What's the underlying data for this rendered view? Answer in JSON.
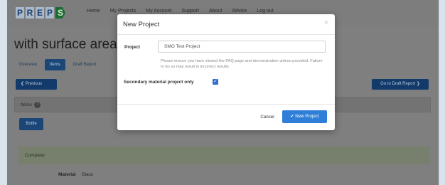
{
  "nav": {
    "logo_letters": [
      "P",
      "R",
      "E",
      "P",
      "S"
    ],
    "items": [
      "Home",
      "My Projects",
      "My Account",
      "Support",
      "About",
      "Advice",
      "Log out"
    ]
  },
  "page": {
    "heading": "with surface area",
    "tabs": [
      "Overview",
      "Items",
      "Draft Report"
    ],
    "active_tab": "Items",
    "prev_button": "❮ Previous",
    "draft_button": "Go to Draft Report ❯",
    "items_section_label": "Items",
    "item_button": "Bottle",
    "complete_label": "Complete",
    "material_label": "Material",
    "material_value": "Glass"
  },
  "modal": {
    "title": "New Project",
    "close_symbol": "×",
    "project_label": "Project",
    "project_value": "SMO Test Project",
    "help_text": "Please ensure you have viewed the FAQ page and demonstration videos provided. Failure to do so may result in incorrect results.",
    "secondary_label": "Secondary material project only",
    "secondary_checked": true,
    "cancel_label": "Cancel",
    "new_project_label": "✔ New Project"
  },
  "colors": {
    "primary_button": "#2f7fd8",
    "checkbox": "#2c6fd1",
    "nav_dark": "#123a6a",
    "complete_bar": "#76806c"
  }
}
